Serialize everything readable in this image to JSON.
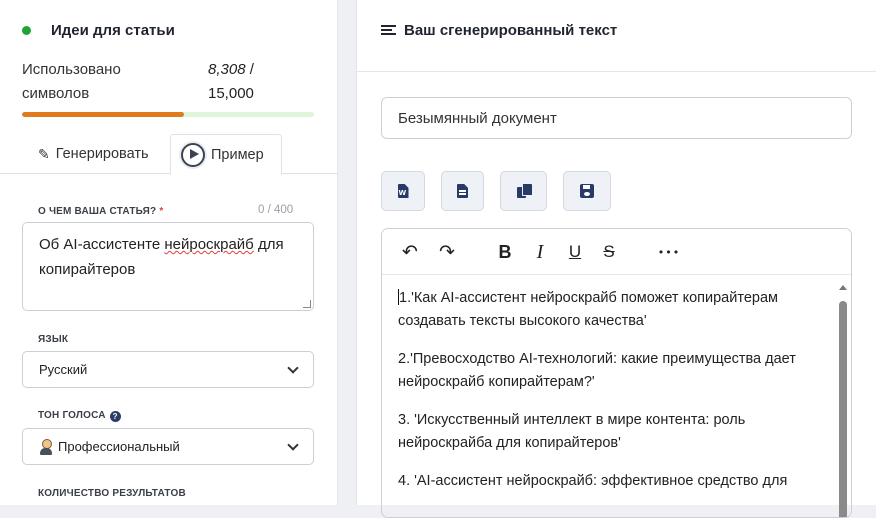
{
  "left_panel": {
    "title": "Идеи для статьи",
    "usage": {
      "label_line1": "Использовано",
      "label_line2": "символов",
      "used": "8,308",
      "separator": " /",
      "limit": "15,000",
      "fraction": 0.554
    },
    "tabs": {
      "generate": "Генерировать",
      "example": "Пример"
    },
    "topic": {
      "label": "О ЧЕМ ВАША СТАТЬЯ?",
      "required_mark": "*",
      "counter": "0 / 400",
      "value_before": "Об AI-ассистенте ",
      "value_misspelled": "нейроскрайб",
      "value_after": " для копирайтеров"
    },
    "language": {
      "label": "ЯЗЫК",
      "value": "Русский"
    },
    "tone": {
      "label": "ТОН ГОЛОСА",
      "help": "?",
      "value": "Профессиональный"
    },
    "results_count": {
      "label": "КОЛИЧЕСТВО РЕЗУЛЬТАТОВ"
    }
  },
  "right_panel": {
    "title": "Ваш сгенерированный текст",
    "document_name": "Безымянный документ",
    "toolbar": {
      "undo": "↶",
      "redo": "↷",
      "bold": "B",
      "italic": "I",
      "underline": "U",
      "strike": "S",
      "more": "•••"
    },
    "content": [
      "1.'Как AI-ассистент нейроскрайб поможет копирайтерам создавать тексты высокого качества'",
      "2.'Превосходство AI-технологий: какие преимущества дает нейроскрайб копирайтерам?'",
      "3. 'Искусственный интеллект в мире контента: роль нейроскрайба для копирайтеров'",
      "4. 'AI-ассистент нейроскрайб: эффективное средство для"
    ]
  },
  "colors": {
    "status_dot": "#21a336",
    "usage_fill": "#e07a1f",
    "usage_track": "#dff5d9",
    "icon_navy": "#283a66"
  }
}
